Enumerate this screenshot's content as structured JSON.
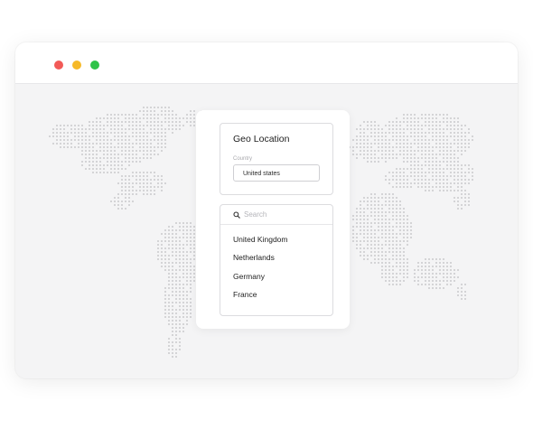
{
  "window": {
    "controls": [
      {
        "name": "close",
        "color": "#f25a57"
      },
      {
        "name": "minimize",
        "color": "#f6b928"
      },
      {
        "name": "maximize",
        "color": "#2fc348"
      }
    ]
  },
  "geo_card": {
    "title": "Geo Location",
    "country_label": "Country",
    "country_value": "United states"
  },
  "search": {
    "placeholder": "Search"
  },
  "country_list": {
    "items": [
      "United Kingdom",
      "Netherlands",
      "Germany",
      "France"
    ]
  }
}
